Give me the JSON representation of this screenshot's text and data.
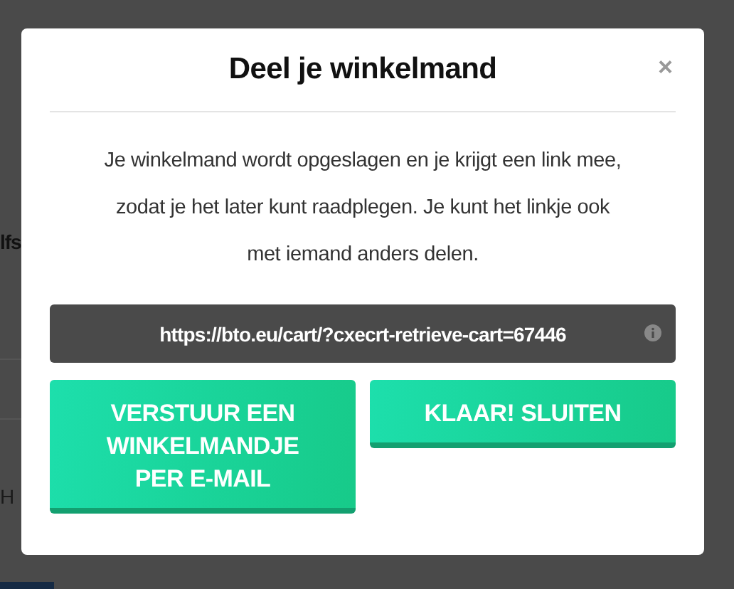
{
  "background": {
    "texts": [
      "lfs",
      "H"
    ]
  },
  "modal": {
    "title": "Deel je winkelmand",
    "close": "×",
    "description": "Je winkelmand wordt opgeslagen en je krijgt een link mee, zodat je het later kunt raadplegen. Je kunt het linkje ook met iemand anders delen.",
    "share_link": "https://bto.eu/cart/?cxecrt-retrieve-cart=67446",
    "buttons": [
      {
        "label": "VERSTUUR EEN WINKELMANDJE PER E-MAIL"
      },
      {
        "label": "KLAAR! SLUITEN"
      }
    ]
  }
}
